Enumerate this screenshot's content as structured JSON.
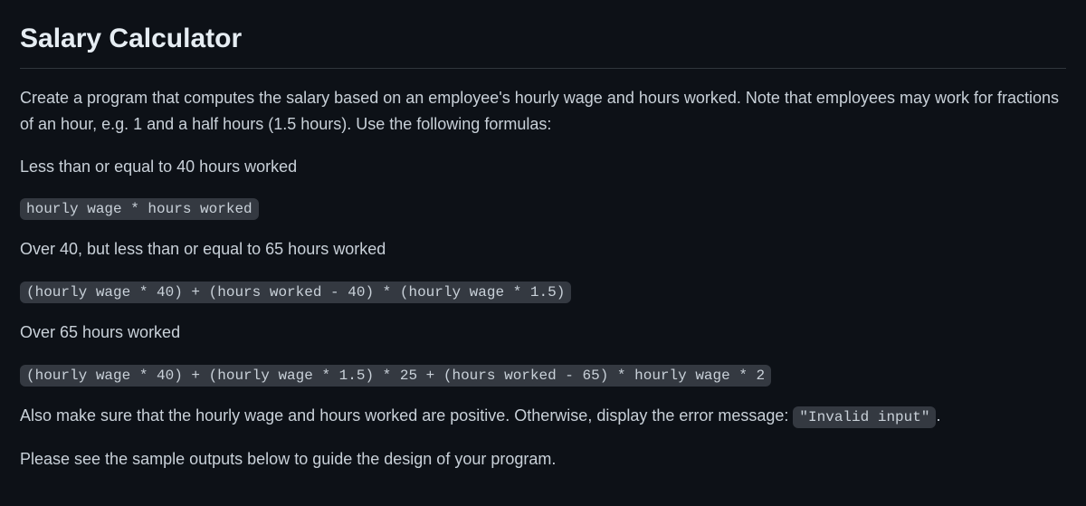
{
  "heading": "Salary Calculator",
  "intro": "Create a program that computes the salary based on an employee's hourly wage and hours worked. Note that employees may work for fractions of an hour, e.g. 1 and a half hours (1.5 hours). Use the following formulas:",
  "case1_label": "Less than or equal to 40 hours worked",
  "case1_formula": "hourly wage * hours worked",
  "case2_label": "Over 40, but less than or equal to 65 hours worked",
  "case2_formula": "(hourly wage * 40) + (hours worked - 40) * (hourly wage * 1.5)",
  "case3_label": "Over 65 hours worked",
  "case3_formula": " (hourly wage * 40) + (hourly wage * 1.5) * 25 + (hours worked - 65) * hourly wage * 2",
  "validation_text_before": "Also make sure that the hourly wage and hours worked are positive. Otherwise, display the error message: ",
  "validation_error": "\"Invalid input\"",
  "validation_text_after": ".",
  "closing": "Please see the sample outputs below to guide the design of your program."
}
